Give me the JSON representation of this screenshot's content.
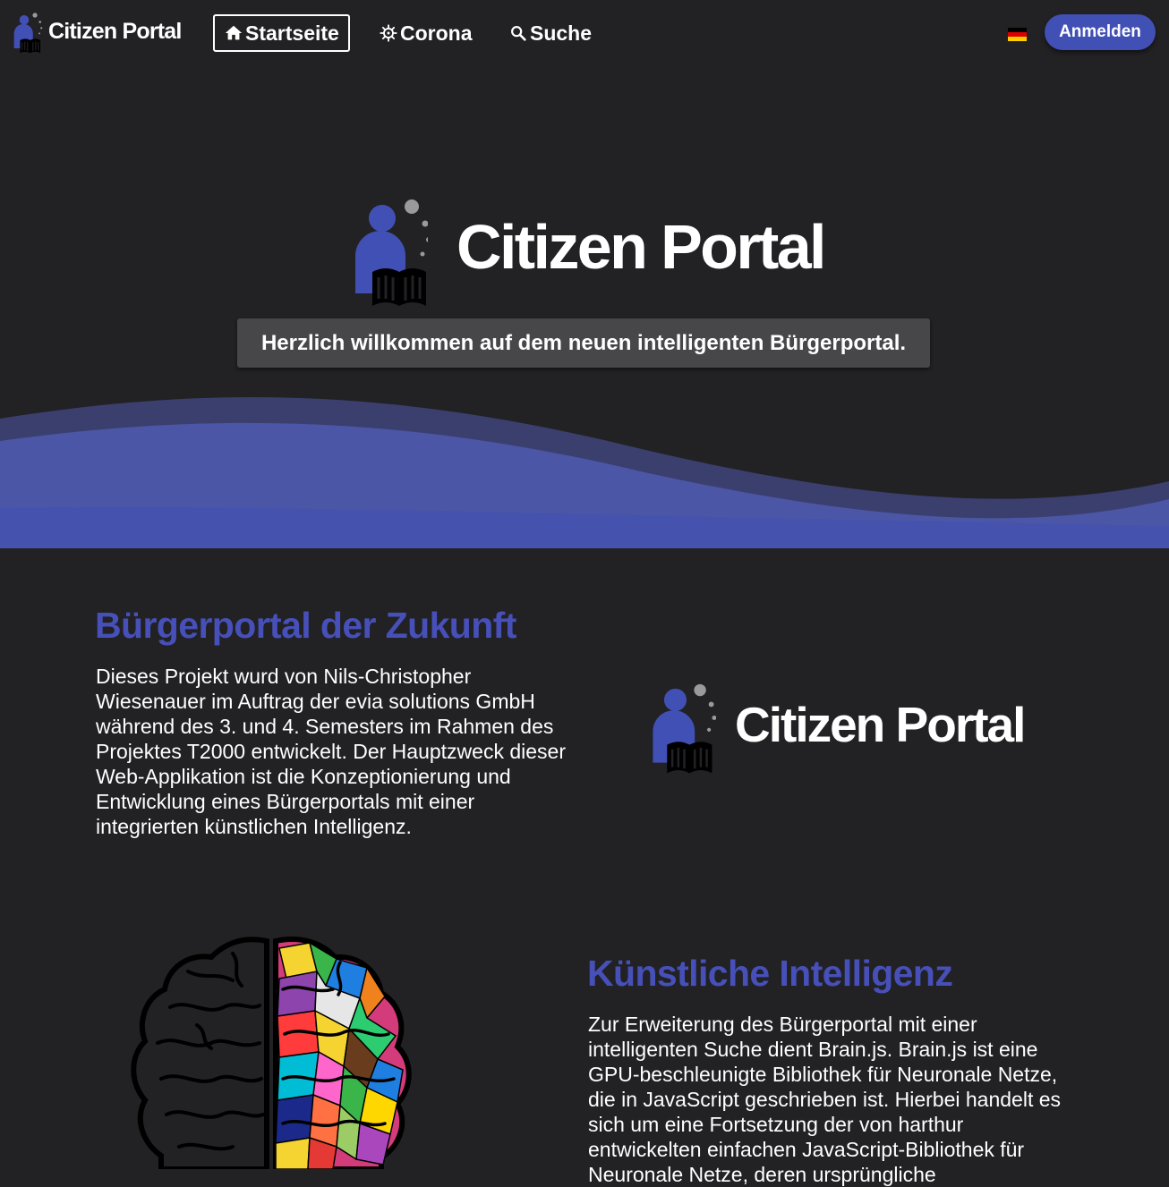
{
  "navbar": {
    "brand": "Citizen Portal",
    "items": [
      {
        "label": "Startseite",
        "icon": "home-icon",
        "active": true
      },
      {
        "label": "Corona",
        "icon": "virus-icon",
        "active": false
      },
      {
        "label": "Suche",
        "icon": "search-icon",
        "active": false
      }
    ],
    "language_flag": "german-flag-icon",
    "login_label": "Anmelden"
  },
  "hero": {
    "title": "Citizen Portal",
    "subtitle": "Herzlich willkommen auf dem neuen intelligenten Bürgerportal."
  },
  "about": {
    "heading": "Bürgerportal der Zukunft",
    "text": "Dieses Projekt wurd von Nils-Christopher Wiesenauer im Auftrag der evia solutions GmbH während des 3. und 4. Semesters im Rahmen des Projektes T2000 entwickelt. Der Hauptzweck dieser Web-Applikation ist die Konzeptionierung und Entwicklung eines Bürgerportals mit einer integrierten künstlichen Intelligenz.",
    "logo_text": "Citizen Portal"
  },
  "ai": {
    "heading": "Künstliche Intelligenz",
    "text": "Zur Erweiterung des Bürgerportal mit einer intelligenten Suche dient Brain.js. Brain.js ist eine GPU-beschleunigte Bibliothek für Neuronale Netze, die in JavaScript geschrieben ist. Hierbei handelt es sich um eine Fortsetzung der von harthur entwickelten einfachen JavaScript-Bibliothek für Neuronale Netze, deren ursprüngliche"
  },
  "colors": {
    "background": "#222124",
    "accent": "#4150b4",
    "heading": "#4650b8",
    "subtitle_box": "#474749",
    "logo_dot": "#9a999e"
  }
}
